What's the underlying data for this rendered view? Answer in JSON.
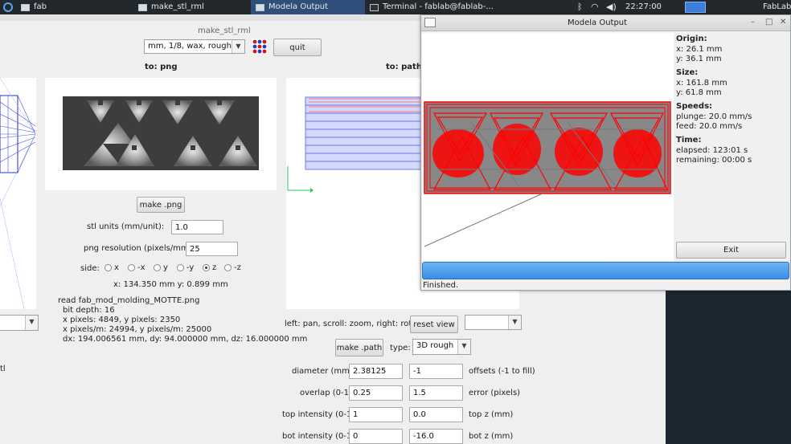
{
  "taskbar": {
    "items": [
      {
        "label": "fab",
        "active": false
      },
      {
        "label": "make_stl_rml",
        "active": false
      },
      {
        "label": "Modela Output",
        "active": true
      },
      {
        "label": "Terminal - fablab@fablab-...",
        "active": false
      }
    ],
    "clock": "22:27:00",
    "workspace_label": "FabLab"
  },
  "main": {
    "title": "make_stl_rml",
    "process_select": "mm, 1/8, wax, rough",
    "quit_label": "quit",
    "png_heading": "to: png",
    "path_heading": "to: path",
    "make_png_label": "make .png",
    "stl_units_label": "stl units (mm/unit):",
    "stl_units_value": "1.0",
    "png_res_label": "png resolution (pixels/mm):",
    "png_res_value": "25",
    "side_label": "side:",
    "side_options": [
      "x",
      "-x",
      "y",
      "-y",
      "z",
      "-z"
    ],
    "side_selected": "z",
    "coords": "x: 134.350 mm  y: 0.899 mm",
    "read_info": [
      "read fab_mod_molding_MOTTE.png",
      "  bit depth: 16",
      "  x pixels: 4849, y pixels: 2350",
      "  x pixels/m: 24994, y pixels/m: 25000",
      "  dx: 194.006561 mm, dy: 94.000000 mm, dz: 16.000000 mm"
    ],
    "left_partial_text": "tl",
    "view_hint": "left: pan, scroll: zoom, right: rotate",
    "reset_view_label": "reset view",
    "make_path_label": "make .path",
    "type_label": "type:",
    "type_value": "3D rough",
    "rows": [
      {
        "label": "diameter (mm)",
        "value1": "2.38125",
        "value2": "-1",
        "note": "offsets (-1 to fill)"
      },
      {
        "label": "overlap (0-1)",
        "value1": "0.25",
        "value2": "1.5",
        "note": "error (pixels)"
      },
      {
        "label": "top intensity (0-1)",
        "value1": "1",
        "value2": "0.0",
        "note": "top z (mm)"
      },
      {
        "label": "bot intensity (0-1)",
        "value1": "0",
        "value2": "-16.0",
        "note": "bot z (mm)"
      }
    ]
  },
  "modela": {
    "title": "Modela Output",
    "origin_heading": "Origin:",
    "origin_x": "x: 26.1 mm",
    "origin_y": "y: 36.1 mm",
    "size_heading": "Size:",
    "size_x": "x: 161.8 mm",
    "size_y": "y: 61.8 mm",
    "speeds_heading": "Speeds:",
    "plunge": "plunge: 20.0 mm/s",
    "feed": "feed: 20.0 mm/s",
    "time_heading": "Time:",
    "elapsed": "elapsed: 123:01 s",
    "remaining": "remaining: 00:00 s",
    "exit_label": "Exit",
    "progress": 1.0,
    "status": "Finished."
  },
  "colors": {
    "toolpath": "#ff0000",
    "progress": "#3a8ee6",
    "taskbar": "#23282d"
  }
}
